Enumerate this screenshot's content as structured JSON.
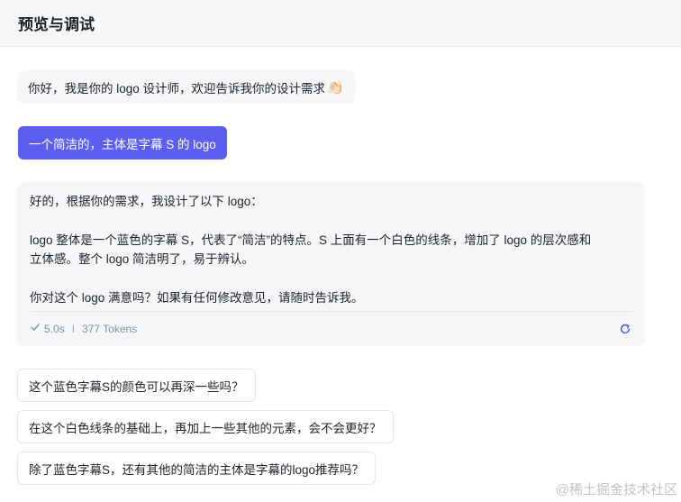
{
  "header": {
    "title": "预览与调试"
  },
  "chat": {
    "greeting": "你好，我是你的 logo 设计师，欢迎告诉我你的设计需求",
    "greeting_emoji": "👏🏻",
    "user_message": "一个简洁的，主体是字幕 S 的 logo",
    "reply": {
      "line1": "好的，根据你的需求，我设计了以下 logo：",
      "line2": "logo 整体是一个蓝色的字幕 S，代表了“简洁”的特点。S 上面有一个白色的线条，增加了 logo 的层次感和",
      "line3": "立体感。整个 logo 简洁明了，易于辨认。",
      "line4": "你对这个 logo 满意吗？如果有任何修改意见，请随时告诉我。",
      "time": "5.0s",
      "separator": "I",
      "tokens": "377 Tokens"
    }
  },
  "suggestions": [
    "这个蓝色字幕S的颜色可以再深一些吗？",
    "在这个白色线条的基础上，再加上一些其他的元素，会不会更好？",
    "除了蓝色字幕S，还有其他的简洁的主体是字幕的logo推荐吗？"
  ],
  "watermark": "@稀土掘金技术社区",
  "colors": {
    "accent": "#5c5ef0",
    "refresh_icon": "#4e5fd6"
  }
}
